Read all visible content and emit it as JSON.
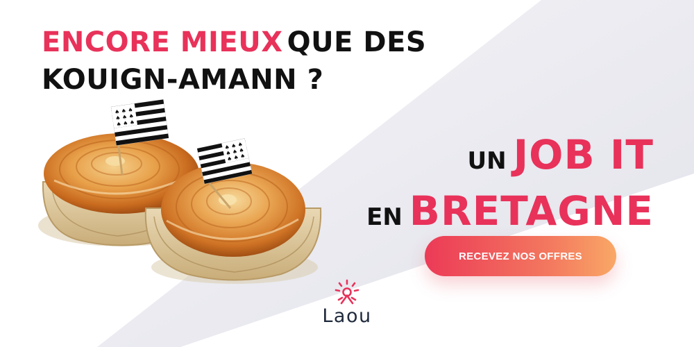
{
  "headline": {
    "line1_pink": "ENCORE MIEUX",
    "line1_black": "QUE DES",
    "line2": "KOUIGN-AMANN ?"
  },
  "tagline": {
    "un": "UN",
    "job_it": "JOB IT",
    "en": "EN",
    "bretagne": "BRETAGNE"
  },
  "cta": {
    "label": "RECEVEZ NOS OFFRES"
  },
  "logo": {
    "text": "Laou",
    "icon": "sun-figure-icon"
  },
  "image": {
    "subject": "two kouign-amann pastries with Breton flags",
    "icon": "flag-of-brittany-icon"
  },
  "colors": {
    "accent_pink": "#e8325a",
    "text_black": "#111111",
    "cta_gradient_start": "#ec3a57",
    "cta_gradient_end": "#f9a866",
    "logo_dark": "#1f2a3c",
    "background_gray": "#e7e7ee"
  }
}
